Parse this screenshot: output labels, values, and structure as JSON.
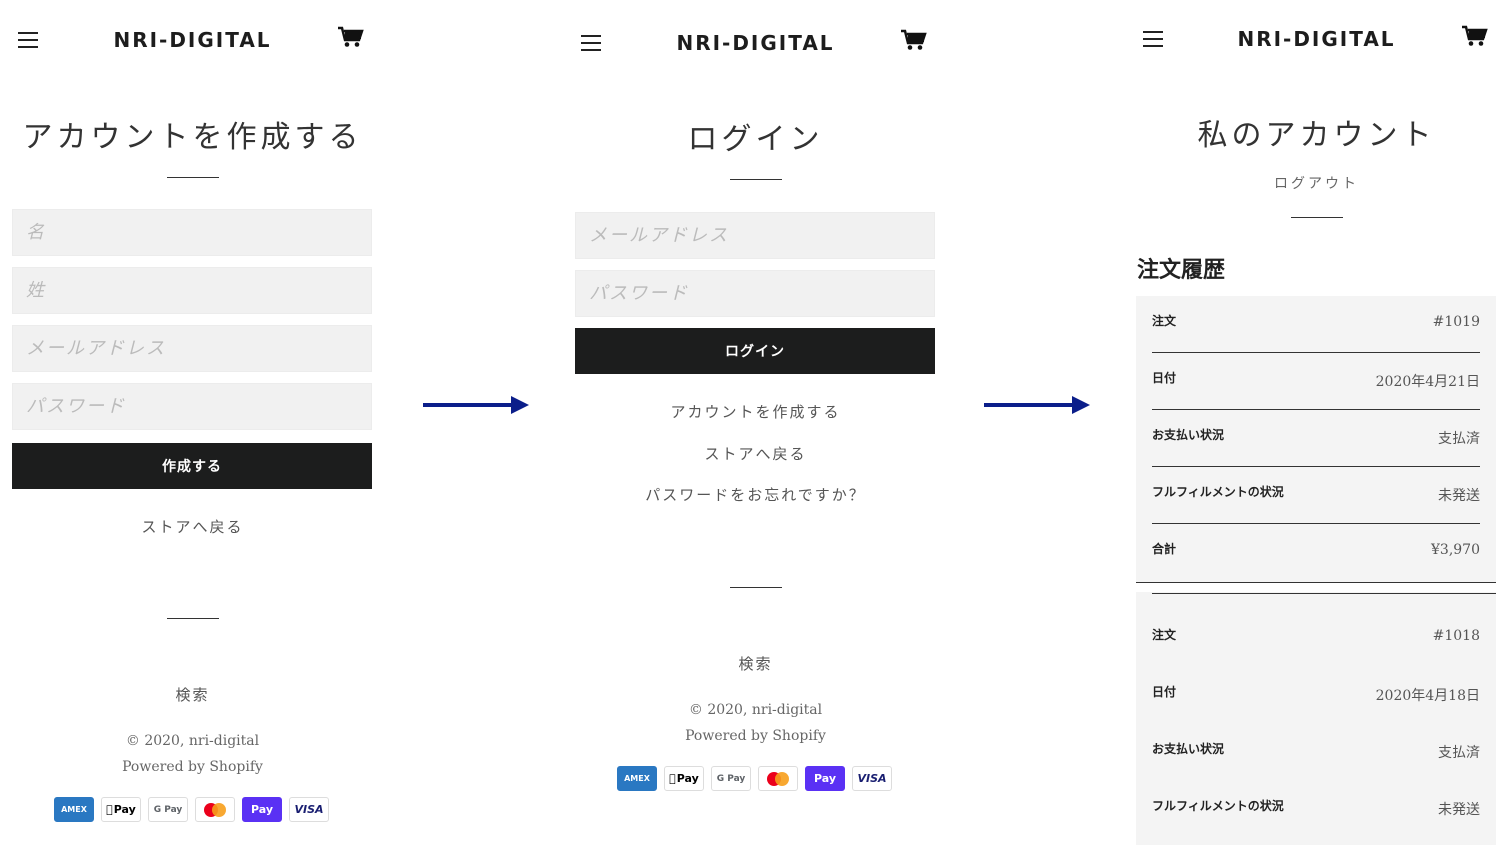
{
  "brand": "NRI-DIGITAL",
  "register": {
    "title": "アカウントを作成する",
    "first_name_placeholder": "名",
    "last_name_placeholder": "姓",
    "email_placeholder": "メールアドレス",
    "password_placeholder": "パスワード",
    "submit_label": "作成する",
    "back_link": "ストアへ戻る",
    "search_link": "検索",
    "copyright": "© 2020, nri-digital",
    "powered": "Powered by Shopify"
  },
  "login": {
    "title": "ログイン",
    "email_placeholder": "メールアドレス",
    "password_placeholder": "パスワード",
    "submit_label": "ログイン",
    "create_link": "アカウントを作成する",
    "back_link": "ストアへ戻る",
    "forgot_link": "パスワードをお忘れですか？",
    "search_link": "検索",
    "copyright": "© 2020, nri-digital",
    "powered": "Powered by Shopify"
  },
  "payment_icons": [
    {
      "name": "amex-icon",
      "label": "AMEX",
      "color": "#2a78c2"
    },
    {
      "name": "apple-pay-icon",
      "label": "Pay",
      "color": "#000000"
    },
    {
      "name": "google-pay-icon",
      "label": "G Pay",
      "color": "#5f6368"
    },
    {
      "name": "mastercard-icon",
      "label": "",
      "color": "#eb001b"
    },
    {
      "name": "shop-pay-icon",
      "label": "Pay",
      "color": "#5a31f4"
    },
    {
      "name": "visa-icon",
      "label": "VISA",
      "color": "#1a1f71"
    }
  ],
  "account": {
    "title": "私のアカウント",
    "logout_link": "ログアウト",
    "orders_heading": "注文履歴",
    "orders": [
      {
        "rows": [
          {
            "label": "注文",
            "value": "#1019"
          },
          {
            "label": "日付",
            "value": "2020年4月21日"
          },
          {
            "label": "お支払い状況",
            "value": "支払済"
          },
          {
            "label": "フルフィルメントの状況",
            "value": "未発送"
          },
          {
            "label": "合計",
            "value": "¥3,970"
          }
        ]
      },
      {
        "rows": [
          {
            "label": "注文",
            "value": "#1018"
          },
          {
            "label": "日付",
            "value": "2020年4月18日"
          },
          {
            "label": "お支払い状況",
            "value": "支払済"
          },
          {
            "label": "フルフィルメントの状況",
            "value": "未発送"
          }
        ]
      }
    ]
  },
  "colors": {
    "button_bg": "#1c1d1d",
    "arrow": "#0b1e8a",
    "field_bg": "#f1f1f1",
    "card_bg": "#f4f4f4"
  }
}
